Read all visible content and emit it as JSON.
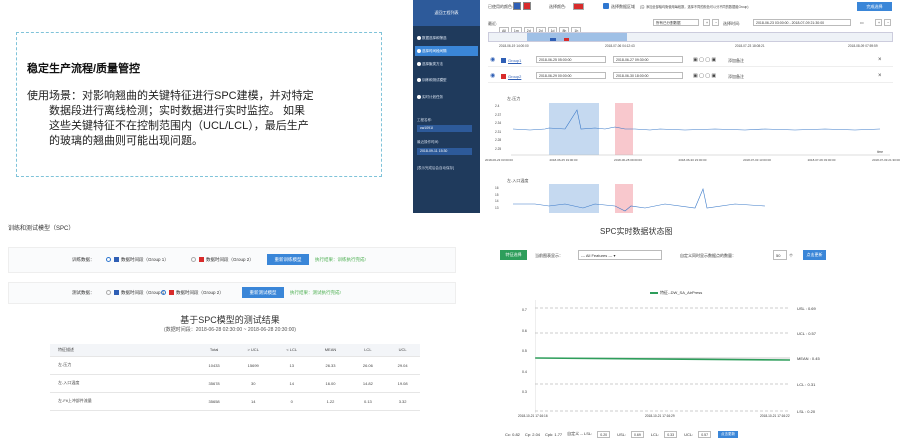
{
  "intro": {
    "title": "稳定生产流程/质量管控",
    "body_line1": "使用场景：对影响翘曲的关键特征进行SPC建模，并对特定",
    "body_line2": "数据段进行离线检测；实时数据进行实时监控。 如果",
    "body_line3": "这些关键特征不在控制范围内（UCL/LCL），最后生产",
    "body_line4": "的玻璃的翘曲则可能出现问题。"
  },
  "sidebar": {
    "header": "返回工程列表",
    "steps": [
      "数据选择和筛选",
      "选择时间段间隔",
      "选择聚类方法",
      "训练和测试模型",
      "实时计划任务"
    ],
    "project_label": "工程名称:",
    "project_value": "cw1091l",
    "time_label": "最近操作时间:",
    "time_value": "2018-09-11 15:30",
    "footer": "[表示完成后会自动保存]"
  },
  "top": {
    "group_color_label": "已使用的颜色:",
    "select_color_label": "选择颜色:",
    "checkbox_label": "选择数据区域",
    "hint": "(注: 添加全部轴均衡使用每段数，选择不同的颜色可以分不同的数据组Group)",
    "done_button": "完成选择",
    "range_label": "最近:",
    "ranges": [
      "All",
      "1m",
      "2d",
      "2d",
      "1d",
      "8h",
      "1h"
    ],
    "dropdown": "所有已分割数据",
    "query_label": "选择时间:",
    "query_value": "2018-06-23 03:00:00 - 2018-07-09 21:30:00",
    "timeline": [
      "2018-06-19 14:00:00",
      "2018-07-06 04:12:43",
      "2018-07-23 18:08:21",
      "2018-08-09 07:59:59"
    ],
    "group1": {
      "name": "Group1",
      "from": "2018-06-25 05:00:00",
      "to": "2018-06-27 09:30:00",
      "add": "添加备注"
    },
    "group2": {
      "name": "Group2",
      "from": "2018-06-29 00:00:00",
      "to": "2018-06-30 18:00:00",
      "add": "添加备注"
    },
    "chart1_title": "左-压力",
    "chart1_y": [
      "2.4",
      "2.37",
      "2.34",
      "2.31",
      "2.28",
      "2.25"
    ],
    "chart1_x": [
      "2018-06-23 03:00:00",
      "2018-06-25 19:00:00",
      "2018-06-28 09:00:00",
      "2018-06-30 23:00:00",
      "2018-07-03 13:00:00",
      "2018-07-06 03:00:00",
      "2018-07-09 21:30:00"
    ],
    "chart1_time_label": "time",
    "chart2_title": "左-入口温度",
    "chart2_y": [
      "16",
      "15",
      "14",
      "13"
    ]
  },
  "train": {
    "section": "训练和测试模型（SPC）",
    "train_label": "训练数据：",
    "g1": "数据时间段（Group 1）",
    "g2": "数据时间段（Group 2）",
    "train_btn": "重新训练模型",
    "train_status": "执行结果：训练执行完成!",
    "test_label": "测试数据：",
    "test_btn": "重新测试模型",
    "test_status": "执行结果：测试执行完成!"
  },
  "result": {
    "title": "基于SPC模型的测试结果",
    "subtitle": "(数据时间段：2018-06-28 02:30:00 ~ 2018-06-28 20:30:00)",
    "columns": [
      "特征描述",
      "Total",
      "> UCL",
      "< LCL",
      "MEAN",
      "LCL",
      "UCL"
    ],
    "rows": [
      [
        "左-压力",
        "10433",
        "15699",
        "13",
        "26.33",
        "26.06",
        "29.04"
      ],
      [
        "左-入口温度",
        "35678",
        "30",
        "14",
        "16.00",
        "14.82",
        "19.08"
      ],
      [
        "左-Fit上冲部件流量",
        "35658",
        "14",
        "0",
        "1.22",
        "0.13",
        "3.32"
      ]
    ]
  },
  "realtime": {
    "title": "SPC实时数据状态图",
    "feature_btn": "特征选择",
    "current_label": "当前图表显示：",
    "current_value": "--- All Features --- ▾",
    "refresh_label": "自定义同时显示数据点的数量：",
    "refresh_value": "50",
    "unit": "个",
    "apply_btn": "点击更新",
    "legend": "特征--DW_SA_AirPress",
    "usl": "USL : 0.69",
    "ucl": "UCL : 0.57",
    "mean": "MEAN : 0.45",
    "lcl": "LCL : 0.31",
    "lsl": "LSL : 0.20",
    "y_ticks": [
      "0.7",
      "0.6",
      "0.5",
      "0.4",
      "0.3",
      "0.2"
    ],
    "x_ticks": [
      "2018-10-21 17:16:16",
      "2018-10-21 17:16:29",
      "2018-10-21 17:16:22"
    ],
    "stats": {
      "cc": "Cc: 0.82",
      "cp": "Cp: 2.04",
      "cpk": "Cpk: 1.77",
      "def_label": "自定义 -- LSL:",
      "lsl": "0.20",
      "usl_label": "USL:",
      "usl": "0.69",
      "lcl_label": "LCL:",
      "lcl": "0.33",
      "ucl_label": "UCL:",
      "ucl": "0.57",
      "btn": "点击更新"
    },
    "series_value": 0.45
  }
}
